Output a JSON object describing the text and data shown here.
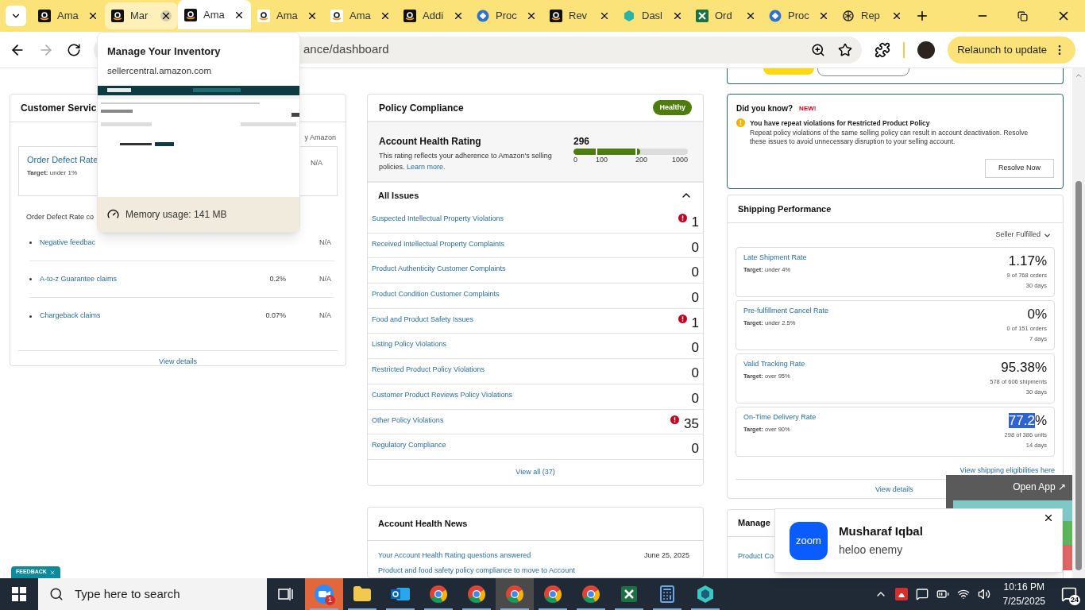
{
  "browser": {
    "tabs": [
      {
        "label": "Ama",
        "kind": "amazon",
        "selected": false,
        "hovered": false
      },
      {
        "label": "Mar",
        "kind": "amazon",
        "selected": false,
        "hovered": true
      },
      {
        "label": "Ama",
        "kind": "amazon",
        "selected": true,
        "hovered": false
      },
      {
        "label": "Ama",
        "kind": "amazon-light",
        "selected": false,
        "hovered": false
      },
      {
        "label": "Ama",
        "kind": "amazon-light",
        "selected": false,
        "hovered": false
      },
      {
        "label": "Addi",
        "kind": "amazon",
        "selected": false,
        "hovered": false
      },
      {
        "label": "Proc",
        "kind": "blue-badge",
        "selected": false,
        "hovered": false
      },
      {
        "label": "Rev",
        "kind": "amazon",
        "selected": false,
        "hovered": false
      },
      {
        "label": "Dasl",
        "kind": "teal-hex",
        "selected": false,
        "hovered": false
      },
      {
        "label": "Ord",
        "kind": "excel",
        "selected": false,
        "hovered": false
      },
      {
        "label": "Proc",
        "kind": "blue-badge",
        "selected": false,
        "hovered": false
      },
      {
        "label": "Rep",
        "kind": "knot",
        "selected": false,
        "hovered": false
      }
    ],
    "address": "ance/dashboard",
    "relaunch_button": "Relaunch to update"
  },
  "tab_preview": {
    "title": "Manage Your Inventory",
    "url": "sellercentral.amazon.com",
    "memory": "Memory usage: 141 MB"
  },
  "customer_service": {
    "title": "Customer Servic",
    "column_label": "y Amazon",
    "main_metric": {
      "name": "Order Defect Rate",
      "target_label": "Target:",
      "target": "under 1%",
      "value": "N/A"
    },
    "breakdown_label": "Order Defect Rate co",
    "rows": [
      {
        "name": "Negative feedbac",
        "value": "",
        "amazon": "N/A"
      },
      {
        "name": "A-to-z Guarantee claims",
        "value": "0.2%",
        "amazon": "N/A"
      },
      {
        "name": "Chargeback claims",
        "value": "0.07%",
        "amazon": "N/A"
      }
    ],
    "link": "View details"
  },
  "policy_compliance": {
    "title": "Policy Compliance",
    "status_label": "Healthy",
    "rating": {
      "title": "Account Health Rating",
      "description": "This rating reflects your adherence to Amazon's selling policies.",
      "learn_more": "Learn more.",
      "score": "296",
      "level": 0.58,
      "ticks": [
        "0",
        "100",
        "200",
        "1000"
      ]
    },
    "issues_title": "All Issues",
    "issues_expanded": true,
    "issues": [
      {
        "name": "Suspected Intellectual Property Violations",
        "count": "1",
        "alert": true
      },
      {
        "name": "Received Intellectual Property Complaints",
        "count": "0",
        "alert": false
      },
      {
        "name": "Product Authenticity Customer Complaints",
        "count": "0",
        "alert": false
      },
      {
        "name": "Product Condition Customer Complaints",
        "count": "0",
        "alert": false
      },
      {
        "name": "Food and Product Safety Issues",
        "count": "1",
        "alert": true
      },
      {
        "name": "Listing Policy Violations",
        "count": "0",
        "alert": false
      },
      {
        "name": "Restricted Product Policy Violations",
        "count": "0",
        "alert": false
      },
      {
        "name": "Customer Product Reviews Policy Violations",
        "count": "0",
        "alert": false
      },
      {
        "name": "Other Policy Violations",
        "count": "35",
        "alert": true
      },
      {
        "name": "Regulatory Compliance",
        "count": "0",
        "alert": false
      }
    ],
    "link": "View all (37)"
  },
  "account_health_news": {
    "title": "Account Health News",
    "items": [
      {
        "title": "Your Account Health Rating questions answered",
        "date": "June 25, 2025"
      },
      {
        "title": "Product and food safety policy compliance to move to Account"
      }
    ]
  },
  "did_you_know": {
    "title": "Did you know?",
    "badge": "NEW!",
    "heading": "You have repeat violations for Restricted Product Policy",
    "body": "Repeat policy violations of the same selling policy can result in account deactivation. Resolve these issues to avoid unnecessary disruption to your selling account.",
    "button": "Resolve Now"
  },
  "shipping_performance": {
    "title": "Shipping Performance",
    "filter": "Seller Fulfilled",
    "metrics": [
      {
        "name": "Late Shipment Rate",
        "target_label": "Target:",
        "target": "under 4%",
        "value": "1.17",
        "unit": "%",
        "highlighted": false,
        "detail": "9 of 768 orders",
        "period": "30 days"
      },
      {
        "name": "Pre-fulfillment Cancel Rate",
        "target_label": "Target:",
        "target": "under 2.5%",
        "value": "0",
        "unit": "%",
        "highlighted": false,
        "detail": "0 of 151 orders",
        "period": "7 days"
      },
      {
        "name": "Valid Tracking Rate",
        "target_label": "Target:",
        "target": "over 95%",
        "value": "95.38",
        "unit": "%",
        "highlighted": false,
        "detail": "578 of 606 shipments",
        "period": "30 days"
      },
      {
        "name": "On-Time Delivery Rate",
        "target_label": "Target:",
        "target": "over 90%",
        "value": "77.2",
        "unit": "%",
        "highlighted": true,
        "detail": "298 of 386 units",
        "period": "14 days"
      }
    ],
    "eligibility_link": "View shipping eligibilities here",
    "link": "View details"
  },
  "manage_card": {
    "title": "Manage",
    "row": "Product Co"
  },
  "open_app": {
    "label": "Open App ↗"
  },
  "notification": {
    "logo": "zoom",
    "sender": "Musharaf Iqbal",
    "message": "heloo enemy"
  },
  "feedback": {
    "label": "FEEDBACK"
  },
  "taskbar": {
    "search_placeholder": "Type here to search",
    "apps": [
      {
        "kind": "zoom",
        "selected": false,
        "badge": "1"
      },
      {
        "kind": "folder",
        "selected": false
      },
      {
        "kind": "outlook",
        "selected": false
      },
      {
        "kind": "chrome",
        "selected": false
      },
      {
        "kind": "chrome",
        "selected": false
      },
      {
        "kind": "chrome",
        "selected": true
      },
      {
        "kind": "chrome",
        "selected": false
      },
      {
        "kind": "chrome",
        "selected": false
      },
      {
        "kind": "excel",
        "selected": false
      },
      {
        "kind": "calculator",
        "selected": false
      },
      {
        "kind": "teal",
        "selected": false
      }
    ],
    "time": "10:16 PM",
    "date": "7/25/2025",
    "notifications": "24"
  }
}
